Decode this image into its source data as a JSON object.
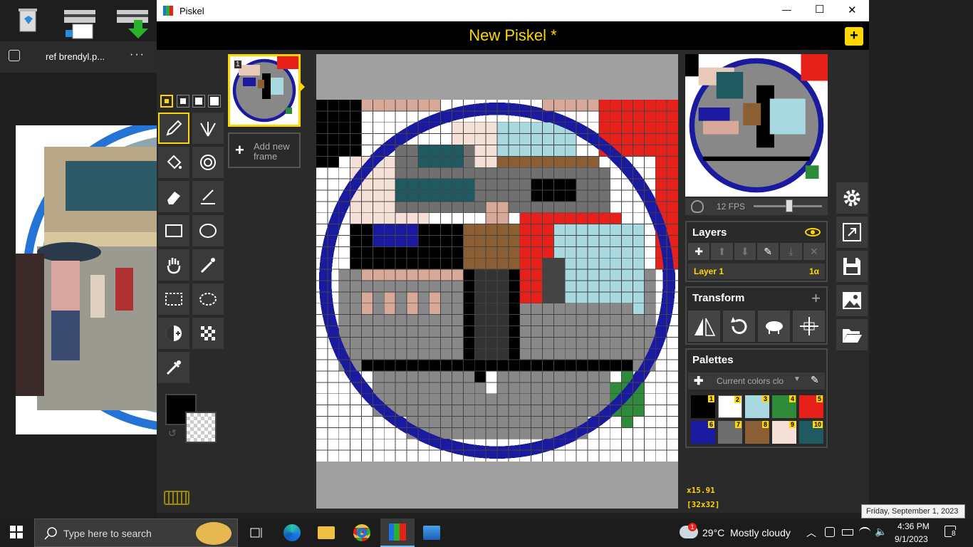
{
  "desktop": {
    "photos_title": "ref brendyl.p...",
    "photos_menu": "···"
  },
  "window": {
    "app_title": "Piskel",
    "minimize": "—",
    "maximize": "☐",
    "close": "✕"
  },
  "header": {
    "title": "New Piskel *",
    "add": "+"
  },
  "frames": {
    "add_label_line1": "Add new",
    "add_label_line2": "frame",
    "frame_number": "1"
  },
  "preview": {
    "fps": "12 FPS",
    "fps_value": 12
  },
  "layers": {
    "title": "Layers",
    "layer_name": "Layer 1",
    "opacity": "1α"
  },
  "transform": {
    "title": "Transform"
  },
  "palettes": {
    "title": "Palettes",
    "selected": "Current colors clo",
    "swatches": [
      {
        "n": "1",
        "c": "#000000"
      },
      {
        "n": "2",
        "c": "#ffffff"
      },
      {
        "n": "3",
        "c": "#a8d8e0"
      },
      {
        "n": "4",
        "c": "#2e8b3a"
      },
      {
        "n": "5",
        "c": "#e8201a"
      },
      {
        "n": "6",
        "c": "#1a1aa0"
      },
      {
        "n": "7",
        "c": "#6e6e6e"
      },
      {
        "n": "8",
        "c": "#8b5e34"
      },
      {
        "n": "9",
        "c": "#f5e0d8"
      },
      {
        "n": "10",
        "c": "#1e5a60"
      }
    ]
  },
  "status": {
    "zoom": "x15.91",
    "size": "[32x32]"
  },
  "colors": {
    "primary": "#000000",
    "accent": "#ffd700"
  },
  "taskbar": {
    "search_placeholder": "Type here to search",
    "weather": "29°C  Mostly cloudy",
    "weather_badge": "1",
    "time": "4:36 PM",
    "date": "9/1/2023",
    "tooltip": "Friday, September 1, 2023",
    "notifications": "8"
  }
}
